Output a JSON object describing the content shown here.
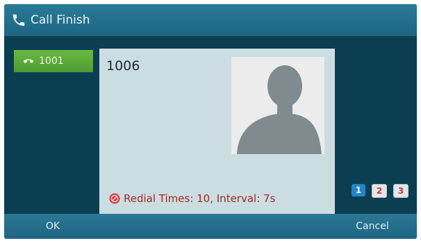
{
  "title_bar": {
    "title": "Call Finish",
    "icon": "phone-icon"
  },
  "line_key": {
    "label": "1001",
    "icon": "handset-icon"
  },
  "call_info": {
    "number": "1006",
    "avatar_icon": "contact-avatar-icon",
    "status_icon": "stop-icon",
    "status_text": "Redial Times: 10, Interval: 7s"
  },
  "page_indicators": [
    {
      "label": "1",
      "active": true
    },
    {
      "label": "2",
      "active": false
    },
    {
      "label": "3",
      "active": false
    }
  ],
  "softkeys": {
    "ok": "OK",
    "cancel": "Cancel"
  },
  "colors": {
    "screen_bg": "#0c3e52",
    "title_bar": "#2a7a96",
    "line_key": "#5fae3b",
    "panel": "#ccdde2",
    "status_text": "#9a2a22"
  }
}
